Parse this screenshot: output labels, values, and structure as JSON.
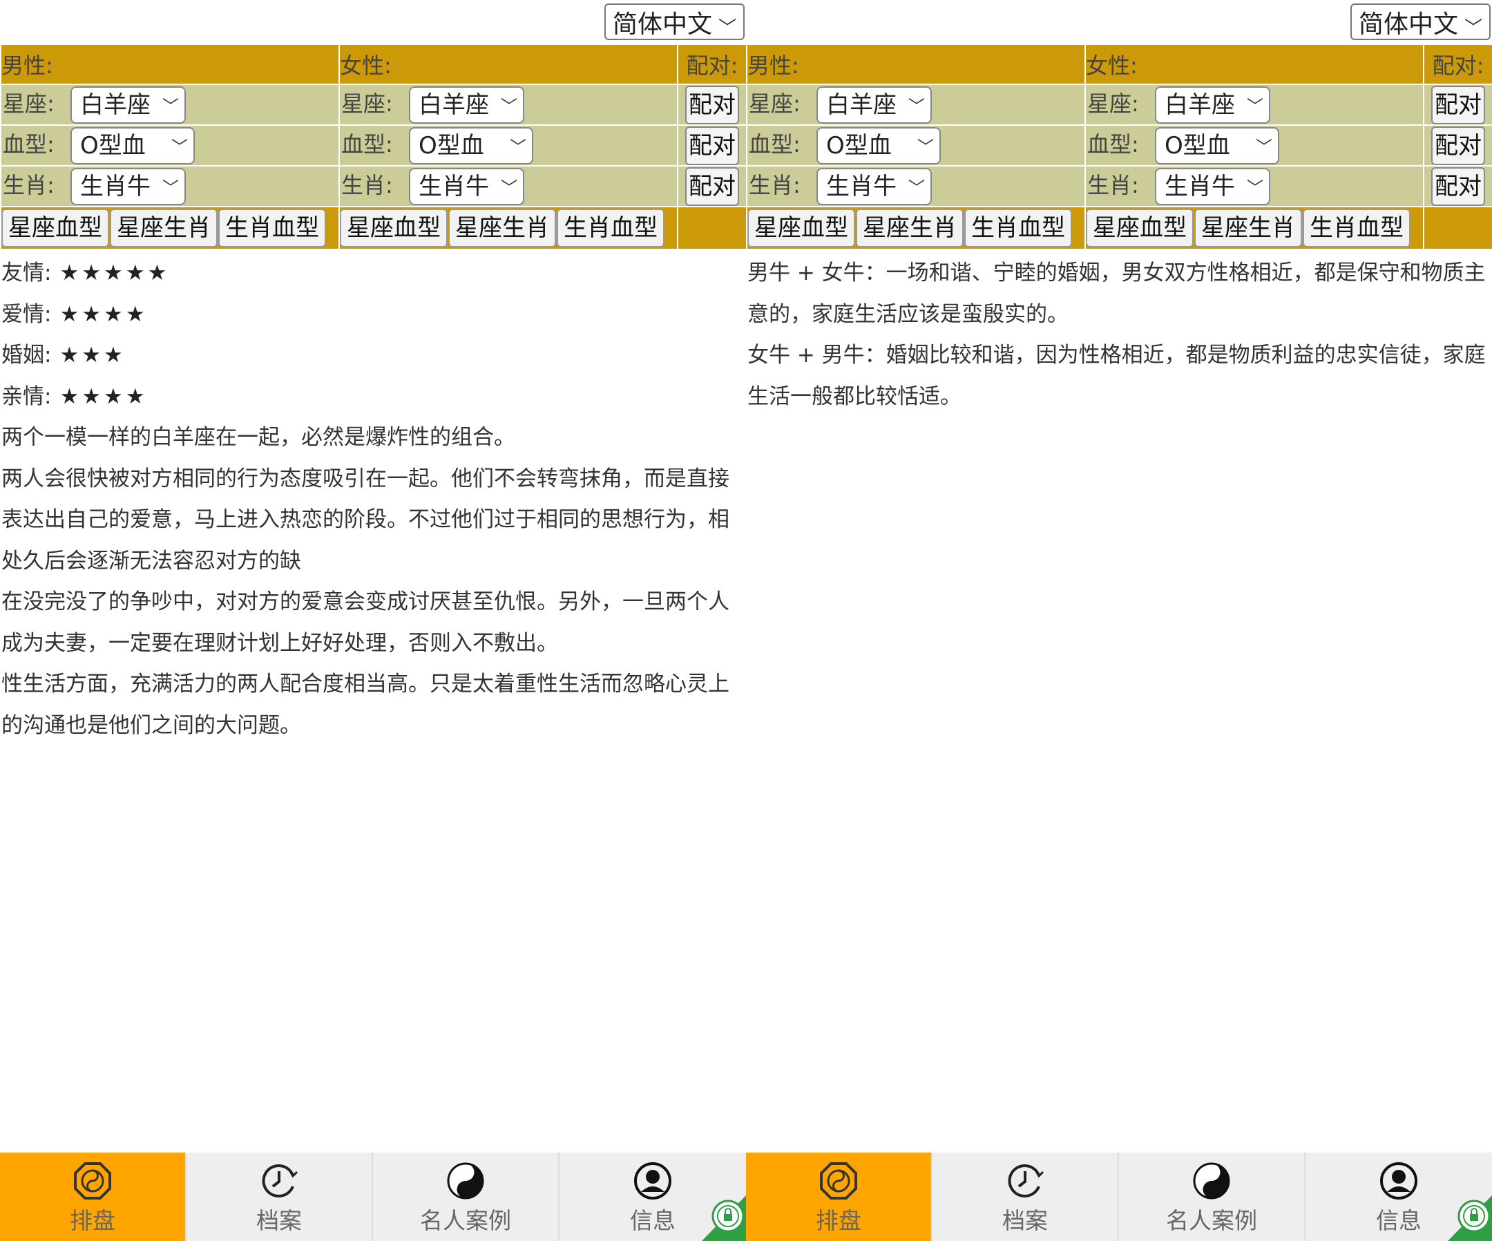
{
  "left": {
    "language": "简体中文",
    "form": {
      "male_label": "男性:",
      "female_label": "女性:",
      "pair_label": "配对:",
      "rows": [
        {
          "label": "星座:",
          "male_value": "白羊座",
          "female_value": "白羊座",
          "pair_button": "配对"
        },
        {
          "label": "血型:",
          "male_value": "O型血",
          "female_value": "O型血",
          "pair_button": "配对"
        },
        {
          "label": "生肖:",
          "male_value": "生肖牛",
          "female_value": "生肖牛",
          "pair_button": "配对"
        }
      ],
      "combo_buttons": [
        "星座血型",
        "星座生肖",
        "生肖血型"
      ]
    },
    "ratings": [
      {
        "label": "友情:",
        "stars": "★★★★★",
        "value": 5
      },
      {
        "label": "爱情:",
        "stars": "★★★★",
        "value": 4
      },
      {
        "label": "婚姻:",
        "stars": "★★★",
        "value": 3
      },
      {
        "label": "亲情:",
        "stars": "★★★★",
        "value": 4
      }
    ],
    "paragraphs": [
      "两个一模一样的白羊座在一起，必然是爆炸性的组合。",
      "两人会很快被对方相同的行为态度吸引在一起。他们不会转弯抹角，而是直接表达出自己的爱意，马上进入热恋的阶段。不过他们过于相同的思想行为，相处久后会逐渐无法容忍对方的缺",
      "在没完没了的争吵中，对对方的爱意会变成讨厌甚至仇恨。另外，一旦两个人成为夫妻，一定要在理财计划上好好处理，否则入不敷出。",
      "性生活方面，充满活力的两人配合度相当高。只是太着重性生活而忽略心灵上的沟通也是他们之间的大问题。"
    ],
    "tabs": [
      {
        "label": "排盘",
        "icon": "bagua-icon",
        "active": true
      },
      {
        "label": "档案",
        "icon": "clock-icon",
        "active": false
      },
      {
        "label": "名人案例",
        "icon": "yin-yang-icon",
        "active": false
      },
      {
        "label": "信息",
        "icon": "user-icon",
        "active": false
      }
    ],
    "badge_icon": "security-certified-badge"
  },
  "right": {
    "language": "简体中文",
    "form": {
      "male_label": "男性:",
      "female_label": "女性:",
      "pair_label": "配对:",
      "rows": [
        {
          "label": "星座:",
          "male_value": "白羊座",
          "female_value": "白羊座",
          "pair_button": "配对"
        },
        {
          "label": "血型:",
          "male_value": "O型血",
          "female_value": "O型血",
          "pair_button": "配对"
        },
        {
          "label": "生肖:",
          "male_value": "生肖牛",
          "female_value": "生肖牛",
          "pair_button": "配对"
        }
      ],
      "combo_buttons": [
        "星座血型",
        "星座生肖",
        "生肖血型"
      ]
    },
    "paragraphs": [
      "男牛 + 女牛：一场和谐、宁睦的婚姻，男女双方性格相近，都是保守和物质主意的，家庭生活应该是蛮殷实的。",
      "女牛 + 男牛：婚姻比较和谐，因为性格相近，都是物质利益的忠实信徒，家庭生活一般都比较恬适。"
    ],
    "tabs": [
      {
        "label": "排盘",
        "icon": "bagua-icon",
        "active": true
      },
      {
        "label": "档案",
        "icon": "clock-icon",
        "active": false
      },
      {
        "label": "名人案例",
        "icon": "yin-yang-icon",
        "active": false
      },
      {
        "label": "信息",
        "icon": "user-icon",
        "active": false
      }
    ],
    "badge_icon": "security-certified-badge"
  },
  "colors": {
    "header_gold": "#cc9a08",
    "row_khaki": "#cccc99",
    "tab_active": "#ffa500",
    "tab_inactive": "#eeeeee"
  }
}
